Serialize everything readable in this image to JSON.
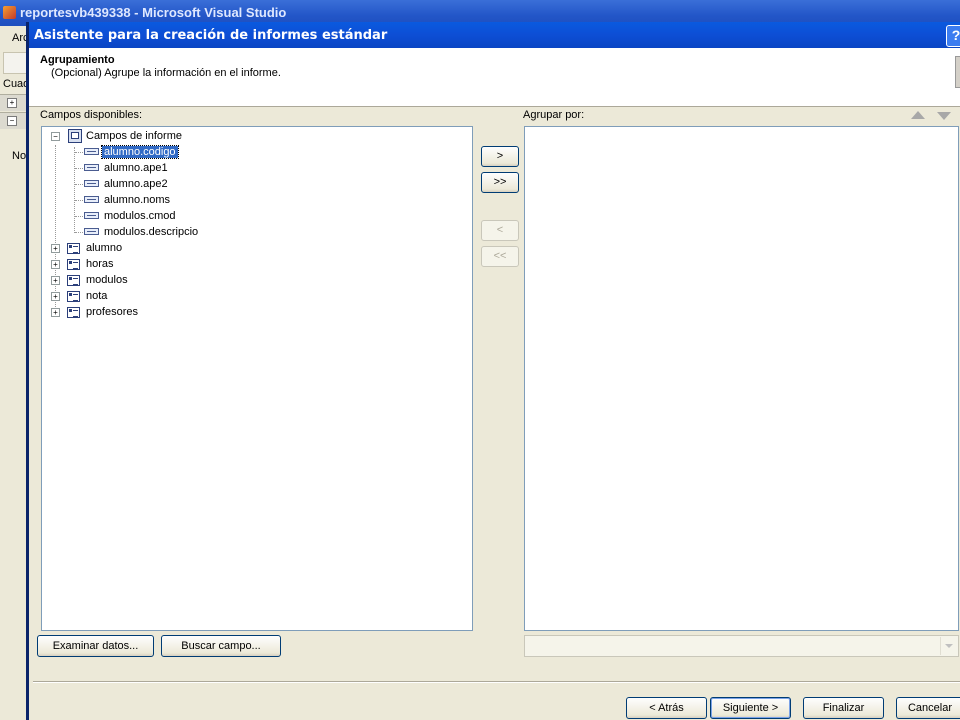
{
  "app": {
    "window_title": "reportesvb439338 - Microsoft Visual Studio",
    "menu_partial": "Arc",
    "panel_partial": "Cuad",
    "left_text": "No"
  },
  "dialog": {
    "title": "Asistente para la creación de informes estándar",
    "help": "?",
    "header_title": "Agrupamiento",
    "header_subtitle": "(Opcional) Agrupe la información en el informe.",
    "available_label": "Campos disponibles:",
    "groupby_label": "Agrupar por:",
    "tree": {
      "root": "Campos de informe",
      "fields": [
        "alumno.codigo",
        "alumno.ape1",
        "alumno.ape2",
        "alumno.noms",
        "modulos.cmod",
        "modulos.descripcio"
      ],
      "tables": [
        "alumno",
        "horas",
        "modulos",
        "nota",
        "profesores"
      ]
    },
    "move_buttons": {
      "add": ">",
      "add_all": ">>",
      "remove": "<",
      "remove_all": "<<"
    },
    "browse_data": "Examinar datos...",
    "find_field": "Buscar campo...",
    "nav": {
      "back": "< Atrás",
      "next": "Siguiente >",
      "finish": "Finalizar",
      "cancel": "Cancelar"
    }
  }
}
